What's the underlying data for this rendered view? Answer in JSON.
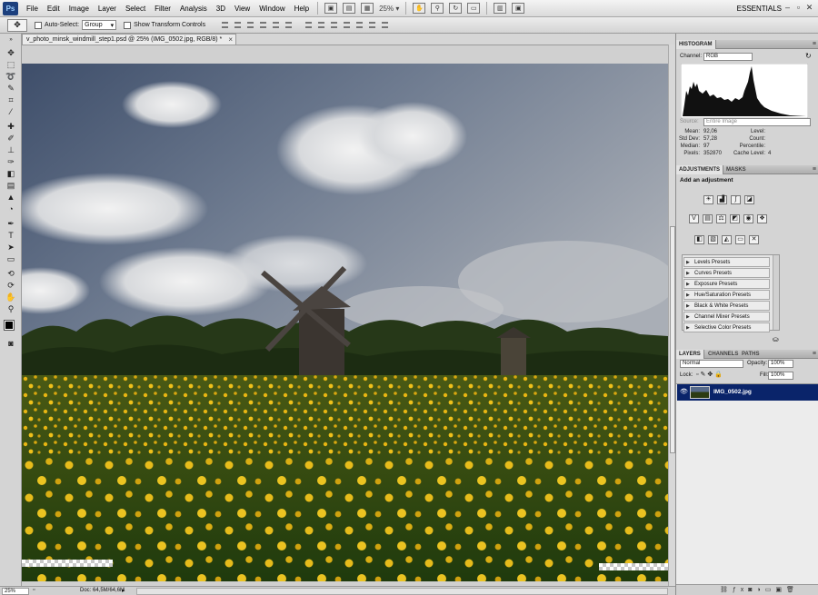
{
  "app": {
    "logo": "Ps",
    "workspace": "ESSENTIALS"
  },
  "menu": [
    "File",
    "Edit",
    "Image",
    "Layer",
    "Select",
    "Filter",
    "Analysis",
    "3D",
    "View",
    "Window",
    "Help"
  ],
  "menubar_zoom": "25%",
  "options": {
    "auto_select_label": "Auto-Select:",
    "auto_select_value": "Group",
    "transform_label": "Show Transform Controls"
  },
  "document": {
    "tab_title": "v_photo_minsk_windmill_step1.psd @ 25% (IMG_0502.jpg, RGB/8) *",
    "tab_close": "×"
  },
  "histogram": {
    "tab": "HISTOGRAM",
    "channel_label": "Channel:",
    "channel": "RGB",
    "source_label": "Source:",
    "source": "Entire Image",
    "stats_left": [
      {
        "k": "Mean:",
        "v": "92,06"
      },
      {
        "k": "Std Dev:",
        "v": "57,28"
      },
      {
        "k": "Median:",
        "v": "97"
      },
      {
        "k": "Pixels:",
        "v": "352870"
      }
    ],
    "stats_right": [
      {
        "k": "Level:",
        "v": ""
      },
      {
        "k": "Count:",
        "v": ""
      },
      {
        "k": "Percentile:",
        "v": ""
      },
      {
        "k": "Cache Level:",
        "v": "4"
      }
    ]
  },
  "adjustments": {
    "tabs": [
      "ADJUSTMENTS",
      "MASKS"
    ],
    "heading": "Add an adjustment",
    "presets": [
      "Levels Presets",
      "Curves Presets",
      "Exposure Presets",
      "Hue/Saturation Presets",
      "Black & White Presets",
      "Channel Mixer Presets",
      "Selective Color Presets"
    ]
  },
  "layers": {
    "tabs": [
      "LAYERS",
      "CHANNELS",
      "PATHS"
    ],
    "blend_mode": "Normal",
    "opacity_label": "Opacity:",
    "opacity": "100%",
    "lock_label": "Lock:",
    "fill_label": "Fill:",
    "fill": "100%",
    "items": [
      {
        "name": "IMG_0502.jpg",
        "selected": true
      }
    ]
  },
  "status": {
    "zoom": "25%",
    "doc": "Doc: 64,5M/64,6M"
  },
  "colors": {
    "accent": "#0a246a",
    "panel_bg": "#d4d4d4"
  }
}
